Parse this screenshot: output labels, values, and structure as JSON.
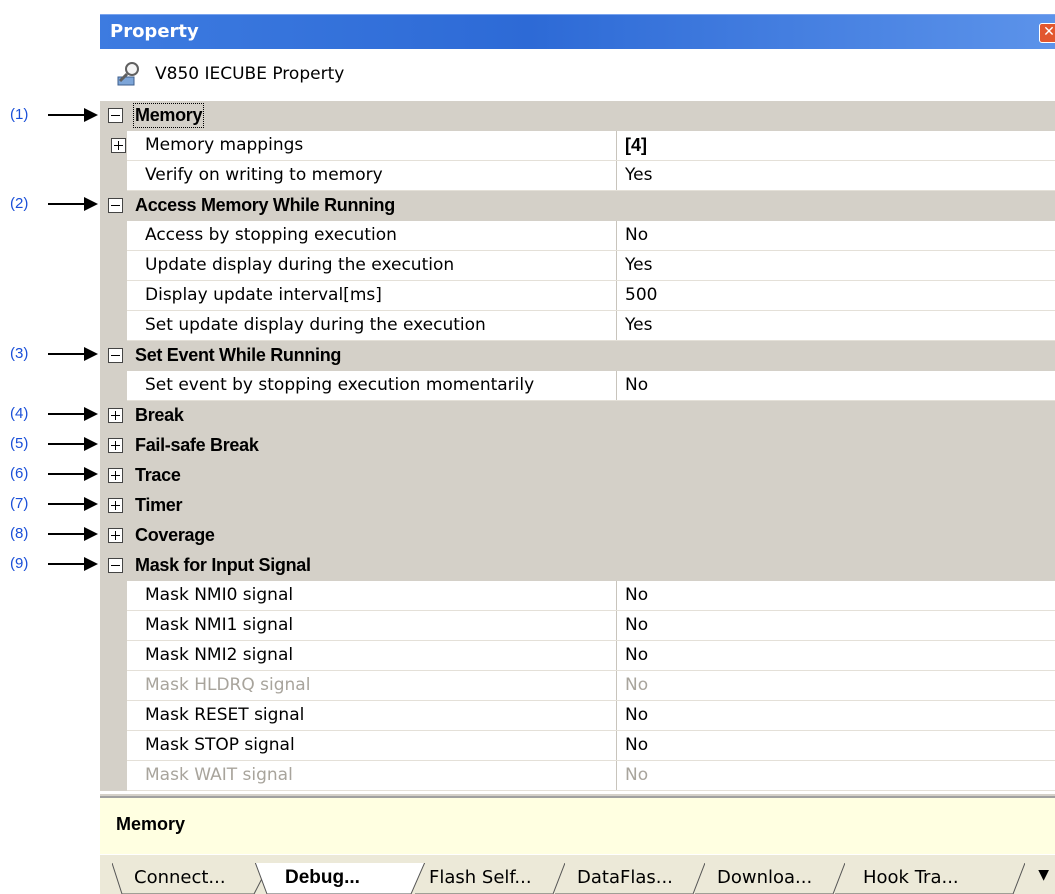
{
  "callouts": [
    "(1)",
    "(2)",
    "(3)",
    "(4)",
    "(5)",
    "(6)",
    "(7)",
    "(8)",
    "(9)"
  ],
  "panel": {
    "title": "Property",
    "close_icon": "close-icon",
    "header": "V850 IECUBE Property",
    "header_icon": "property-wrench-icon"
  },
  "categories": {
    "memory": "Memory",
    "access_memory": "Access Memory While Running",
    "set_event": "Set Event While Running",
    "break": "Break",
    "failsafe": "Fail-safe Break",
    "trace": "Trace",
    "timer": "Timer",
    "coverage": "Coverage",
    "mask_input": "Mask for Input Signal"
  },
  "props": {
    "memory_mappings": {
      "name": "Memory mappings",
      "value": "[4]"
    },
    "verify_writing": {
      "name": "Verify on writing to memory",
      "value": "Yes"
    },
    "access_stop": {
      "name": "Access by stopping execution",
      "value": "No"
    },
    "update_display": {
      "name": "Update display during the execution",
      "value": "Yes"
    },
    "update_interval": {
      "name": "Display update interval[ms]",
      "value": "500"
    },
    "set_update_display": {
      "name": "Set update display during the execution",
      "value": "Yes"
    },
    "set_event_stop": {
      "name": "Set event by stopping execution momentarily",
      "value": "No"
    },
    "mask_nmi0": {
      "name": "Mask NMI0 signal",
      "value": "No"
    },
    "mask_nmi1": {
      "name": "Mask NMI1 signal",
      "value": "No"
    },
    "mask_nmi2": {
      "name": "Mask NMI2 signal",
      "value": "No"
    },
    "mask_hldrq": {
      "name": "Mask HLDRQ signal",
      "value": "No"
    },
    "mask_reset": {
      "name": "Mask RESET signal",
      "value": "No"
    },
    "mask_stop": {
      "name": "Mask STOP signal",
      "value": "No"
    },
    "mask_wait": {
      "name": "Mask WAIT signal",
      "value": "No"
    }
  },
  "description": "Memory",
  "tabs": [
    "Connect...",
    "Debug...",
    "Flash Self...",
    "DataFlas...",
    "Downloa...",
    "Hook Tra..."
  ],
  "active_tab": "Debug...",
  "colors": {
    "title_bar": "#2d6ad6",
    "category_bg": "#d4d0c8",
    "description_bg": "#ffffe1",
    "callout_text": "#1a4fd8"
  }
}
